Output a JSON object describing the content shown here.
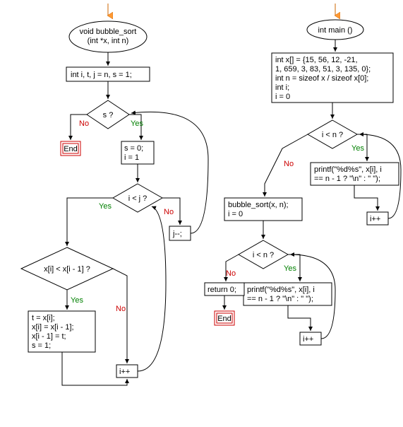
{
  "flowchart_left": {
    "title": "void bubble_sort",
    "title2": "(int *x, int n)",
    "init": "int i, t, j = n, s = 1;",
    "decision1": "s ?",
    "end": "End",
    "block1_l1": "s = 0;",
    "block1_l2": "i = 1",
    "decision2": "i < j ?",
    "decrement_j": "j--;",
    "decision3": "x[i] < x[i - 1] ?",
    "swap_l1": "t = x[i];",
    "swap_l2": "x[i] = x[i - 1];",
    "swap_l3": "x[i - 1] = t;",
    "swap_l4": "s = 1;",
    "increment_i": "i++"
  },
  "flowchart_right": {
    "title": "int main ()",
    "init_l1": "int x[] = {15, 56, 12, -21,",
    "init_l2": "1, 659, 3, 83, 51, 3, 135, 0};",
    "init_l3": "int n = sizeof x / sizeof x[0];",
    "init_l4": "int i;",
    "init_l5": "i = 0",
    "decision1": "i < n ?",
    "call_l1": "bubble_sort(x, n);",
    "call_l2": "i = 0",
    "printf1_l1": "printf(\"%d%s\", x[i], i",
    "printf1_l2": "== n - 1 ? \"\\n\" : \" \");",
    "increment_i1": "i++",
    "decision2": "i < n ?",
    "return": "return 0;",
    "end": "End",
    "printf2_l1": "printf(\"%d%s\", x[i], i",
    "printf2_l2": "== n - 1 ? \"\\n\" : \" \");",
    "increment_i2": "i++"
  },
  "labels": {
    "yes": "Yes",
    "no": "No"
  }
}
